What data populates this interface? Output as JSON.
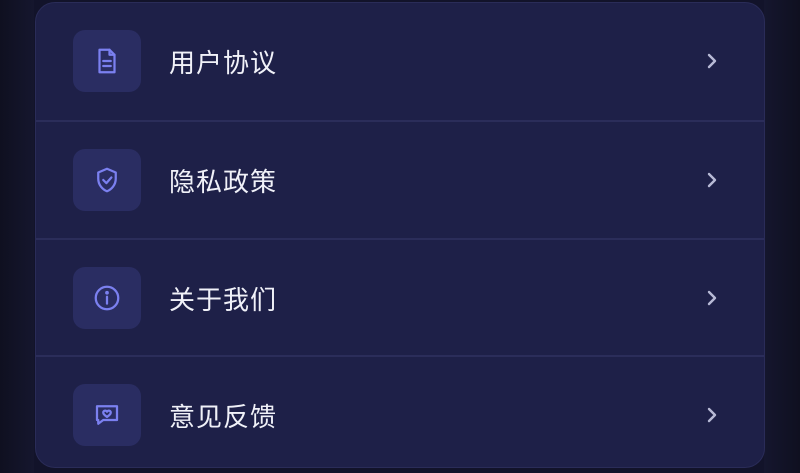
{
  "menu": {
    "items": [
      {
        "label": "用户协议",
        "icon": "document-icon"
      },
      {
        "label": "隐私政策",
        "icon": "shield-check-icon"
      },
      {
        "label": "关于我们",
        "icon": "info-icon"
      },
      {
        "label": "意见反馈",
        "icon": "heart-message-icon"
      }
    ]
  },
  "colors": {
    "card_bg": "#1e2048",
    "icon_bg": "#2a2d62",
    "icon_accent": "#7b80f0",
    "text": "#f0f1f8",
    "chevron": "#b8bad6"
  }
}
